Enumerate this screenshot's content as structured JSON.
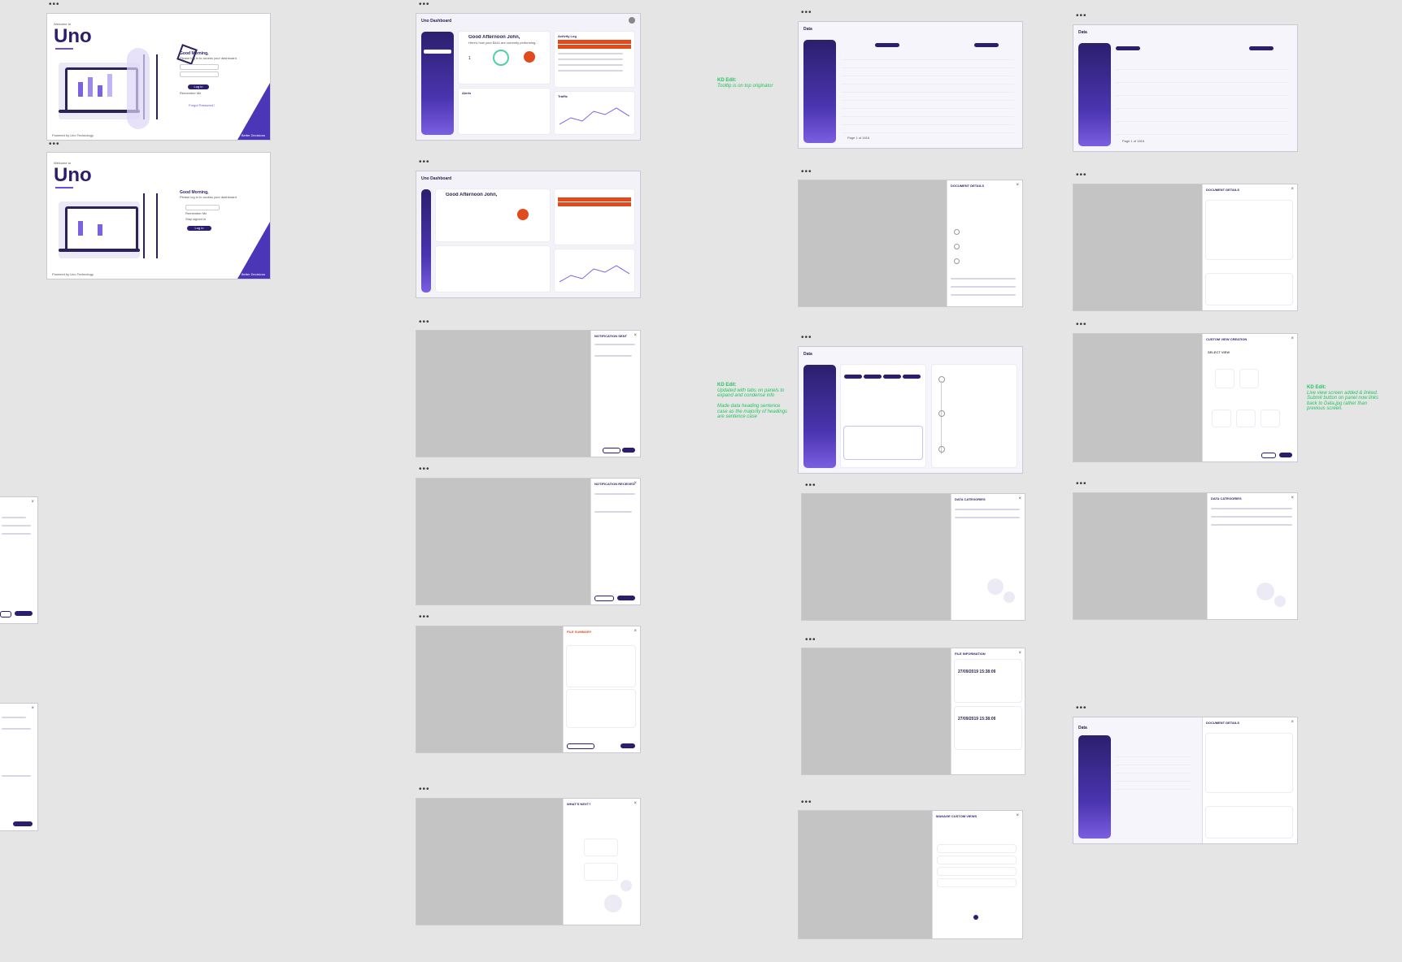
{
  "login": {
    "welcome": "Welcome to",
    "logo": "Uno",
    "greeting": "Good Morning,",
    "subtitle": "Please log in to access your dashboard",
    "login_button": "Log in",
    "remember": "Remember Me",
    "forgot": "Forgot Password?",
    "footer_left": "Powered by Uno Technology",
    "footer_right": "Data + Better Decisions",
    "option_a": "Remember Me",
    "option_b": "Stay signed in"
  },
  "dashboard": {
    "title": "Uno Dashboard",
    "greeting": "Good Afternoon John,",
    "subtitle": "Here's how your $444 are currently performing...",
    "counts": [
      "1",
      "2",
      "3"
    ],
    "gauge_value": "3344",
    "alert_value": "8",
    "activity_title": "Activity Log",
    "alerts_title": "Alerts",
    "traffic_title": "Traffic"
  },
  "data_page": {
    "title": "Data",
    "breadcrumb": "Data Management",
    "tabs": [
      "Data Management",
      "Data Explorer",
      "Data Models",
      "Document Log"
    ],
    "add_button": "+ Add Document",
    "pagination": "Page 1 of 1616",
    "sidebar_items": [
      "Home",
      "Data",
      "Document Reports",
      "Reporting Tool",
      "Settings"
    ]
  },
  "notes": [
    {
      "head": "KD Edit:",
      "body": "Tooltip is on top originator"
    },
    {
      "head": "KD Edit:",
      "body": "Updated with tabs on panels to expand and condense info",
      "body2": "Made data heading sentence case as the majority of headings are sentence case"
    },
    {
      "head": "KD Edit:",
      "body": "Live view screen added & linked. Submit button on panel now links back to Data.jpg rather than previous screen."
    }
  ],
  "panels": {
    "notification": "NOTIFICATION SENT",
    "notification_received": "NOTIFICATION RECEIVED",
    "file_summary": "FILE SUMMARY",
    "next_step": "WHAT'S NEXT?",
    "document_details": "DOCUMENT DETAILS",
    "file_info": "FILE INFORMATION",
    "new_data": "DATA CATEGORIES",
    "manage_views": "MANAGE CUSTOM VIEWS",
    "custom_view": "CUSTOM VIEW CREATION",
    "select_view": "SELECT VIEW",
    "file_date": "27/09/2019 15:38:09"
  }
}
